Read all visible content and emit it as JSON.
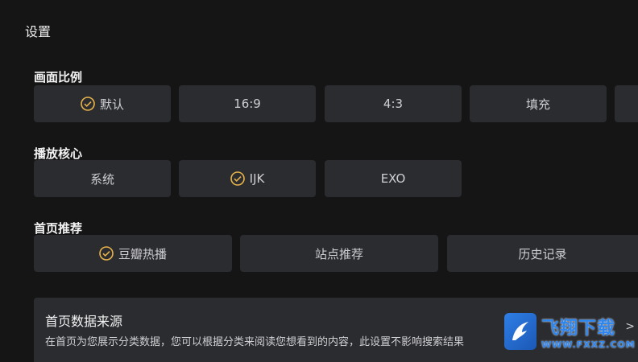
{
  "page": {
    "title": "设置"
  },
  "sections": {
    "aspect": {
      "label": "画面比例",
      "options": [
        "默认",
        "16:9",
        "4:3",
        "填充",
        ""
      ],
      "selected": 0
    },
    "core": {
      "label": "播放核心",
      "options": [
        "系统",
        "IJK",
        "EXO"
      ],
      "selected": 1
    },
    "home": {
      "label": "首页推荐",
      "options": [
        "豆瓣热播",
        "站点推荐",
        "历史记录"
      ],
      "selected": 0
    }
  },
  "source_card": {
    "title": "首页数据来源",
    "description": "在首页为您展示分类数据，您可以根据分类来阅读您想看到的内容，此设置不影响搜索结果",
    "arrow": ">"
  },
  "watermark": {
    "name": "飞翔下载",
    "url": "WWW.FXXZ.COM"
  },
  "colors": {
    "check": "#e8b44a",
    "button_bg": "#2b2c30",
    "background": "#151516"
  }
}
